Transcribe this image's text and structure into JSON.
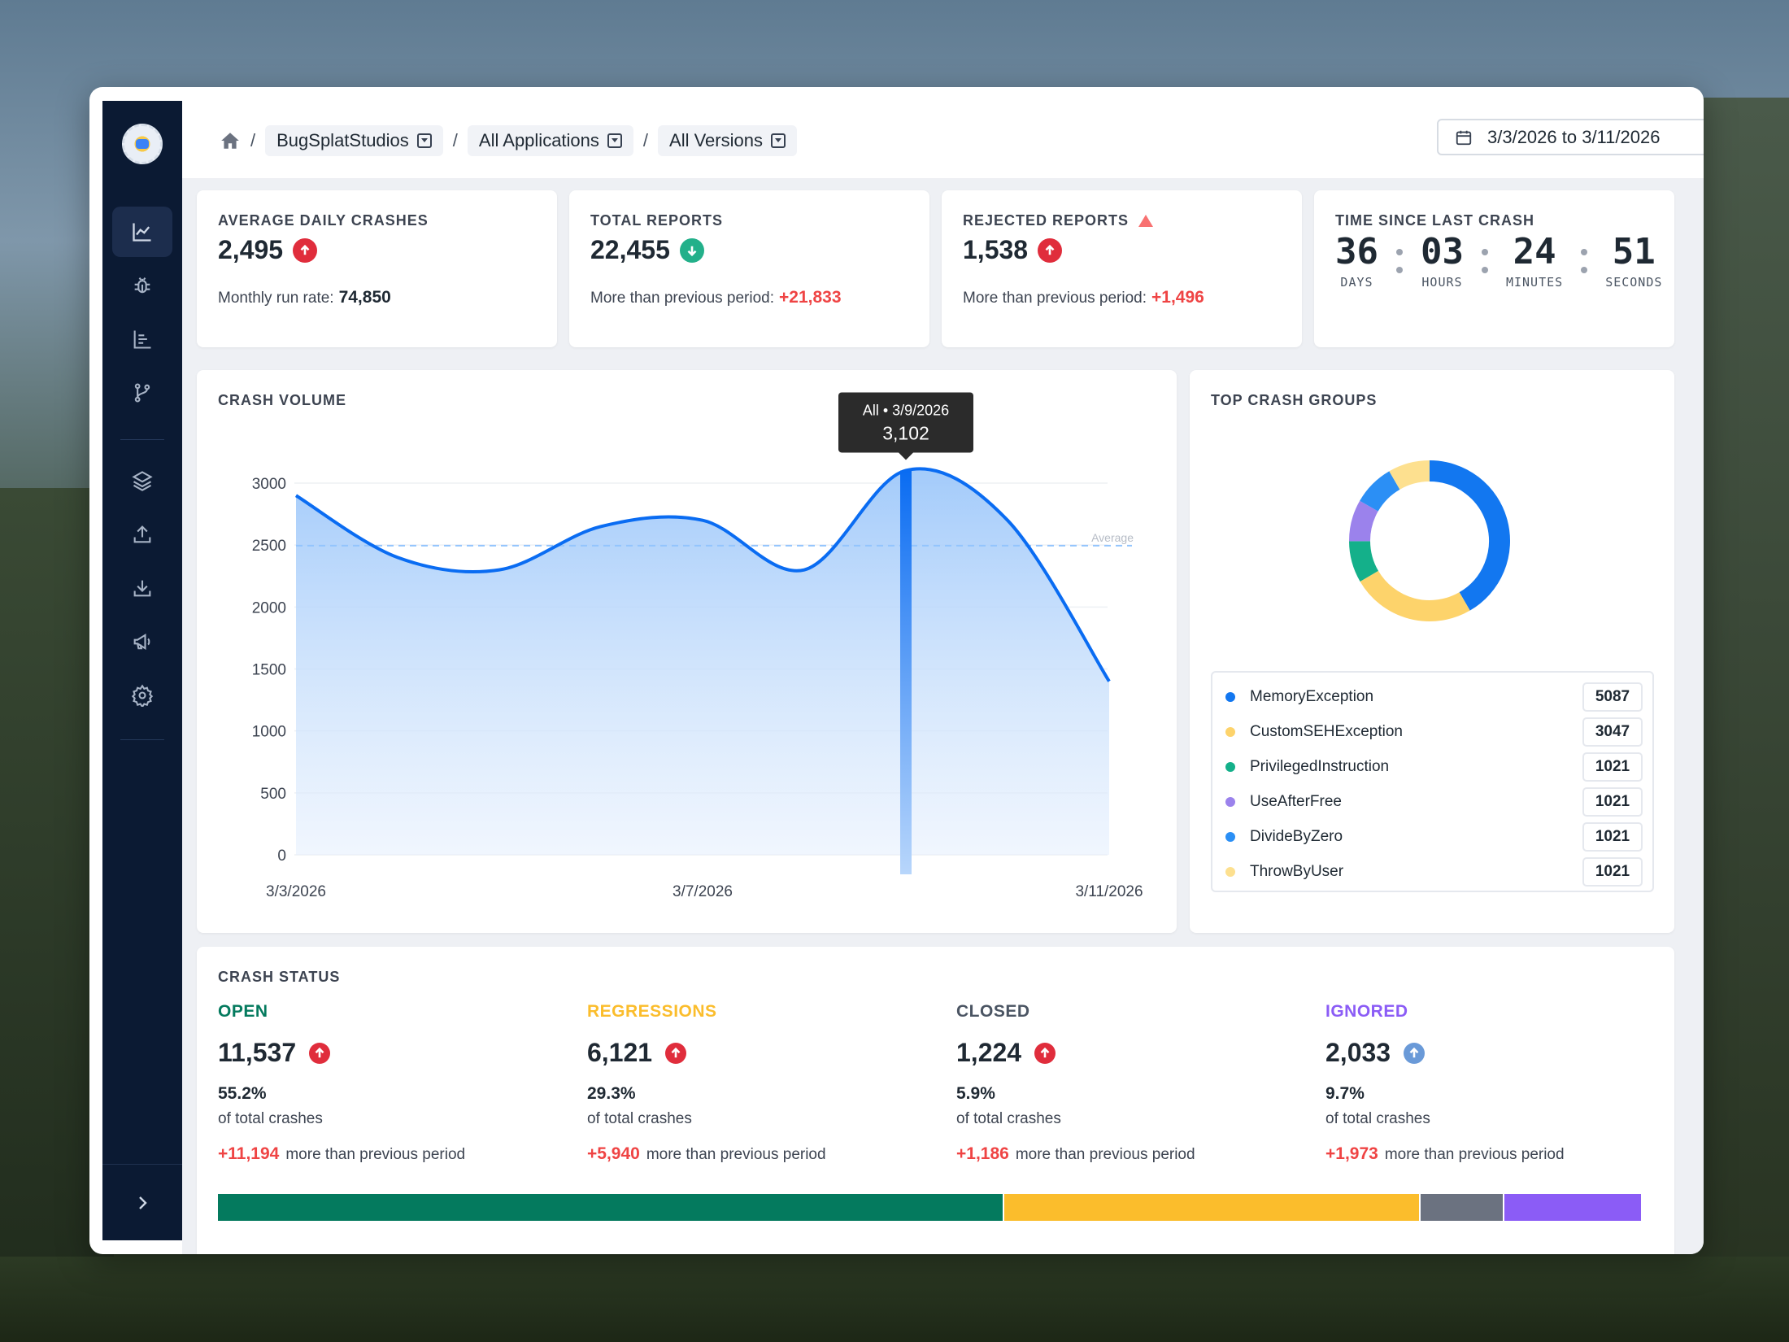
{
  "breadcrumb": {
    "items": [
      "BugSplatStudios",
      "All Applications",
      "All Versions"
    ],
    "separator": "/"
  },
  "date_range": "3/3/2026 to 3/11/2026",
  "kpis": {
    "avg_daily": {
      "title": "AVERAGE DAILY CRASHES",
      "value": "2,495",
      "sub_label": "Monthly run rate:",
      "sub_value": "74,850"
    },
    "total_reports": {
      "title": "TOTAL REPORTS",
      "value": "22,455",
      "sub_label": "More than previous period:",
      "sub_value": "+21,833"
    },
    "rejected_reports": {
      "title": "REJECTED REPORTS",
      "value": "1,538",
      "sub_label": "More than previous period:",
      "sub_value": "+1,496"
    },
    "time_since": {
      "title": "TIME SINCE LAST CRASH",
      "days": "36",
      "hours": "03",
      "minutes": "24",
      "seconds": "51",
      "days_label": "DAYS",
      "hours_label": "HOURS",
      "minutes_label": "MINUTES",
      "seconds_label": "SECONDS"
    }
  },
  "crash_volume": {
    "title": "CRASH VOLUME",
    "tooltip_title": "All • 3/9/2026",
    "tooltip_value": "3,102",
    "average_label": "Average"
  },
  "chart_data": {
    "type": "area",
    "x_tick_labels": [
      "3/3/2026",
      "3/7/2026",
      "3/11/2026"
    ],
    "x": [
      "3/3/2026",
      "3/4/2026",
      "3/5/2026",
      "3/6/2026",
      "3/7/2026",
      "3/8/2026",
      "3/9/2026",
      "3/10/2026",
      "3/11/2026"
    ],
    "values": [
      2900,
      2400,
      2300,
      2650,
      2700,
      2300,
      3102,
      2700,
      1400
    ],
    "highlight_x": "3/9/2026",
    "average": 2495,
    "ylim": [
      0,
      3000
    ],
    "y_ticks": [
      0,
      500,
      1000,
      1500,
      2000,
      2500,
      3000
    ],
    "grid": true,
    "color": "#0a6cf2"
  },
  "top_groups": {
    "title": "TOP CRASH GROUPS",
    "items": [
      {
        "name": "MemoryException",
        "value": "5087",
        "color": "#1277f0"
      },
      {
        "name": "CustomSEHException",
        "value": "3047",
        "color": "#fdd36b"
      },
      {
        "name": "PrivilegedInstruction",
        "value": "1021",
        "color": "#14b08a"
      },
      {
        "name": "UseAfterFree",
        "value": "1021",
        "color": "#9b82ec"
      },
      {
        "name": "DivideByZero",
        "value": "1021",
        "color": "#2b8ff5"
      },
      {
        "name": "ThrowByUser",
        "value": "1021",
        "color": "#fde08f"
      }
    ]
  },
  "crash_status": {
    "title": "CRASH STATUS",
    "of_total": "of total crashes",
    "more_label": "more than previous period",
    "open": {
      "label": "OPEN",
      "value": "11,537",
      "pct": "55.2%",
      "delta": "+11,194",
      "color": "#047a5e",
      "fraction": 0.552
    },
    "regressions": {
      "label": "REGRESSIONS",
      "value": "6,121",
      "pct": "29.3%",
      "delta": "+5,940",
      "color": "#fbbd2c",
      "fraction": 0.293
    },
    "closed": {
      "label": "CLOSED",
      "value": "1,224",
      "pct": "5.9%",
      "delta": "+1,186",
      "color": "#6b7280",
      "fraction": 0.059
    },
    "ignored": {
      "label": "IGNORED",
      "value": "2,033",
      "pct": "9.7%",
      "delta": "+1,973",
      "color": "#8b5cf6",
      "fraction": 0.097
    }
  }
}
